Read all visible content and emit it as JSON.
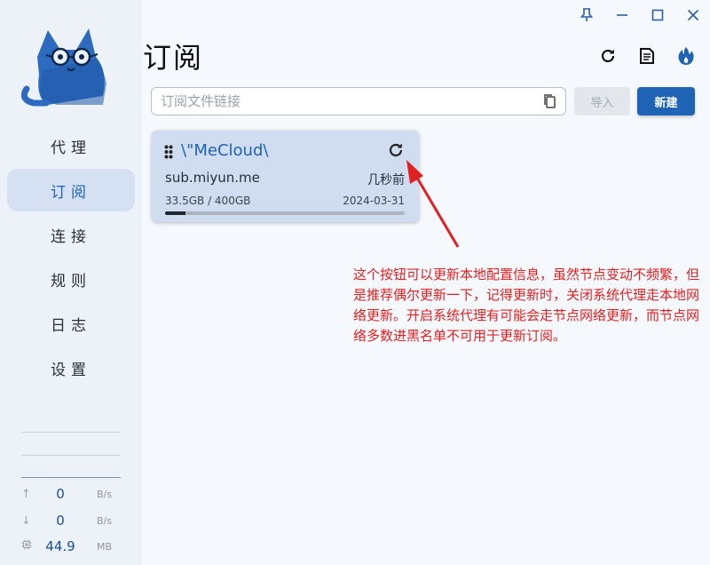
{
  "window": {
    "controls": [
      {
        "name": "pin-icon",
        "glyph": "pin"
      },
      {
        "name": "minimize-icon",
        "glyph": "minimize"
      },
      {
        "name": "maximize-icon",
        "glyph": "maximize"
      },
      {
        "name": "close-icon",
        "glyph": "close"
      }
    ]
  },
  "sidebar": {
    "logo_icon": "cat-with-glasses-logo",
    "items": [
      {
        "label": "代理",
        "active": false
      },
      {
        "label": "订阅",
        "active": true
      },
      {
        "label": "连接",
        "active": false
      },
      {
        "label": "规则",
        "active": false
      },
      {
        "label": "日志",
        "active": false
      },
      {
        "label": "设置",
        "active": false
      }
    ],
    "stats": {
      "upload": {
        "value": "0",
        "unit": "B/s",
        "icon": "arrow-up-icon"
      },
      "download": {
        "value": "0",
        "unit": "B/s",
        "icon": "arrow-down-icon"
      },
      "memory": {
        "value": "44.9",
        "unit": "MB",
        "icon": "memory-chip-icon"
      }
    }
  },
  "header": {
    "title": "订阅",
    "actions": [
      "refresh-icon",
      "document-icon",
      "fire-icon"
    ]
  },
  "subscription_input": {
    "value": "",
    "placeholder": "订阅文件链接",
    "import_label": "导入",
    "new_label": "新建"
  },
  "subscriptions": [
    {
      "name": "\\\"MeCloud\\",
      "host": "sub.miyun.me",
      "updated": "几秒前",
      "usage": "33.5GB / 400GB",
      "usage_fraction": 0.084,
      "expire": "2024-03-31"
    }
  ],
  "annotation": {
    "text": "这个按钮可以更新本地配置信息，虽然节点变动不频繁，但是推荐偶尔更新一下，记得更新时，关闭系统代理走本地网络更新。开启系统代理有可能会走节点网络更新，而节点网络多数进黑名单不可用于更新订阅。",
    "color": "#e32020"
  },
  "colors": {
    "accent": "#1e63b6",
    "sidebar_bg": "#edf2f9",
    "active_bg": "#d5e1f2",
    "card_bg": "#d0dcef"
  }
}
